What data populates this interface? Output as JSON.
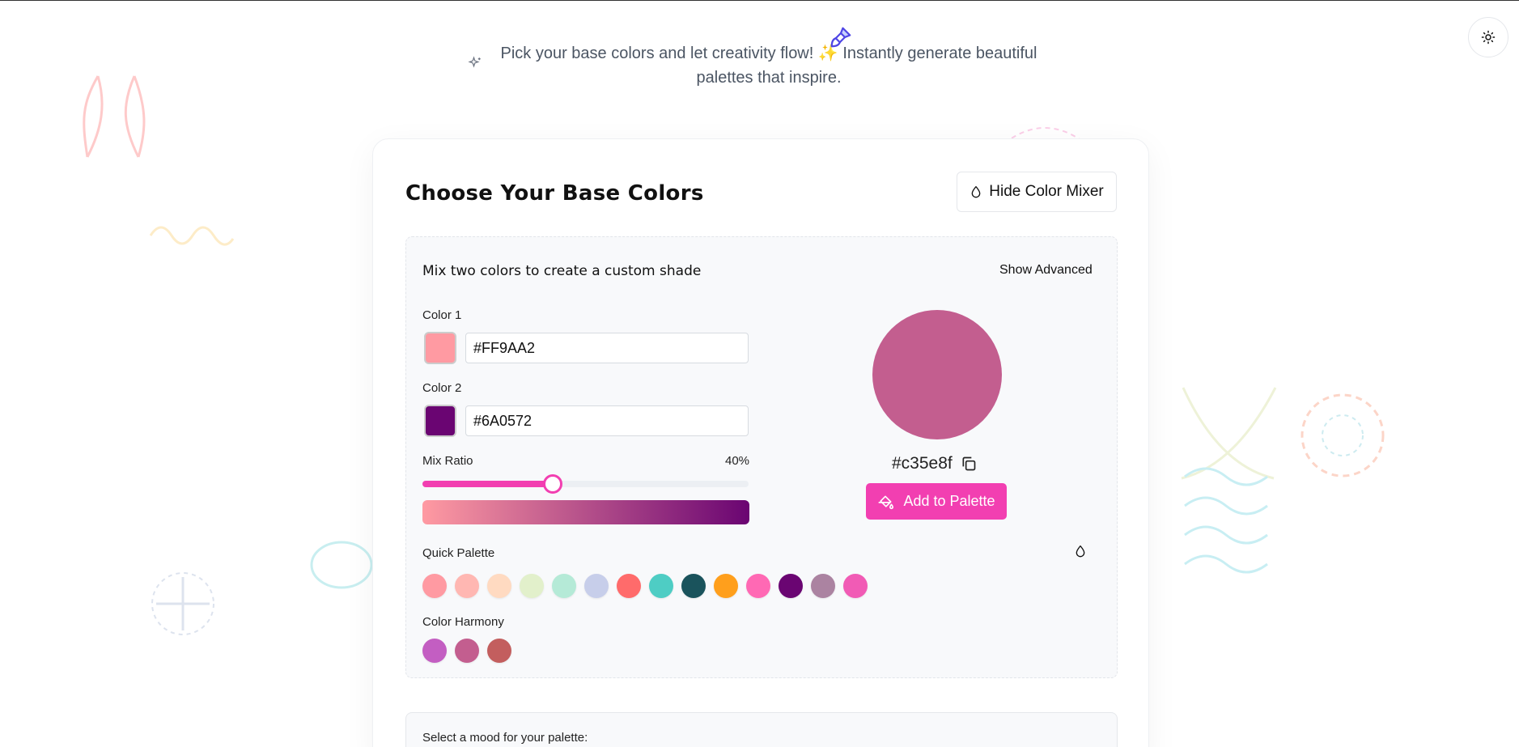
{
  "hero": {
    "line1": "Pick your base colors and let creativity flow! ✨ Instantly generate beautiful",
    "line2": "palettes that inspire."
  },
  "card": {
    "title": "Choose Your Base Colors",
    "hide_mixer_label": "Hide Color Mixer"
  },
  "mixer": {
    "subtitle": "Mix two colors to create a custom shade",
    "advanced_label": "Show Advanced",
    "color1": {
      "label": "Color 1",
      "value": "#FF9AA2"
    },
    "color2": {
      "label": "Color 2",
      "value": "#6A0572"
    },
    "ratio": {
      "label": "Mix Ratio",
      "value_text": "40%",
      "value": 0.4
    },
    "result": {
      "hex": "#c35e8f",
      "color": "#c35e8f"
    },
    "add_label": "Add to Palette"
  },
  "quick_palette": {
    "label": "Quick Palette",
    "colors": [
      "#FF9AA2",
      "#FFB7B2",
      "#FFDAC1",
      "#E2F0CB",
      "#B5EAD7",
      "#C7CEEA",
      "#FF6B6B",
      "#4ECDC4",
      "#1A535C",
      "#FF9F1C",
      "#FF69B4",
      "#6A0572",
      "#AB83A1",
      "#F15BB5"
    ]
  },
  "harmony": {
    "label": "Color Harmony",
    "colors": [
      "#c35ec2",
      "#c35e8f",
      "#c35e5e"
    ]
  },
  "mood": {
    "label": "Select a mood for your palette:"
  },
  "accent": "#f23fb1"
}
